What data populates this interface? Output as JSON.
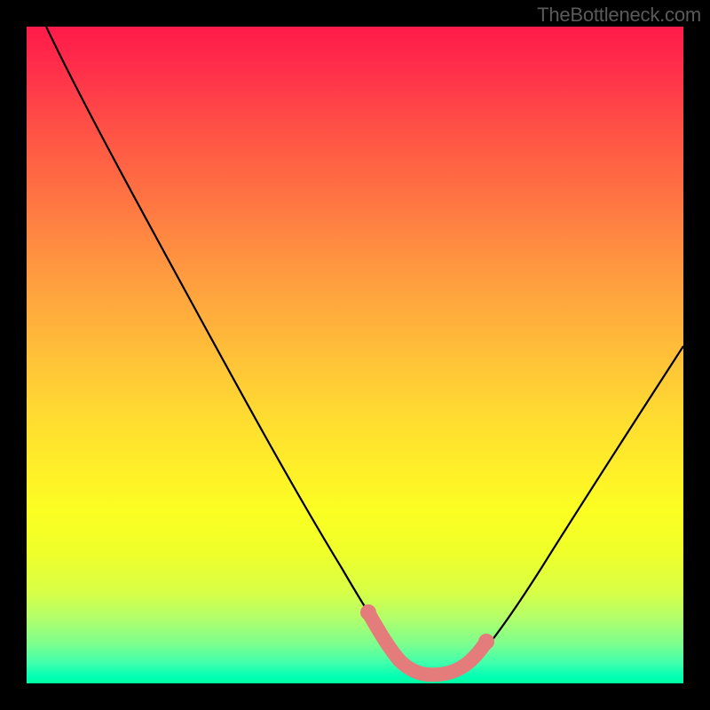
{
  "watermark": "TheBottleneck.com",
  "chart_data": {
    "type": "line",
    "title": "",
    "xlabel": "",
    "ylabel": "",
    "xlim": [
      0,
      100
    ],
    "ylim": [
      0,
      100
    ],
    "series": [
      {
        "name": "bottleneck-curve",
        "x": [
          3,
          10,
          20,
          30,
          40,
          48,
          52,
          55,
          58,
          62,
          65,
          67,
          68,
          72,
          78,
          85,
          92,
          100
        ],
        "y": [
          100,
          86,
          68,
          51,
          34,
          20,
          12,
          6,
          3,
          2,
          2,
          3,
          5,
          10,
          18,
          28,
          40,
          52
        ]
      },
      {
        "name": "highlight-band",
        "x": [
          52,
          55,
          58,
          62,
          65,
          67,
          68
        ],
        "y": [
          12,
          6,
          3,
          2,
          2,
          3,
          5
        ]
      }
    ],
    "colors": {
      "curve": "#000000",
      "highlight": "#e57c7c",
      "gradient_top": "#ff1b4a",
      "gradient_mid": "#ffdd30",
      "gradient_bottom": "#00ff9e"
    }
  }
}
